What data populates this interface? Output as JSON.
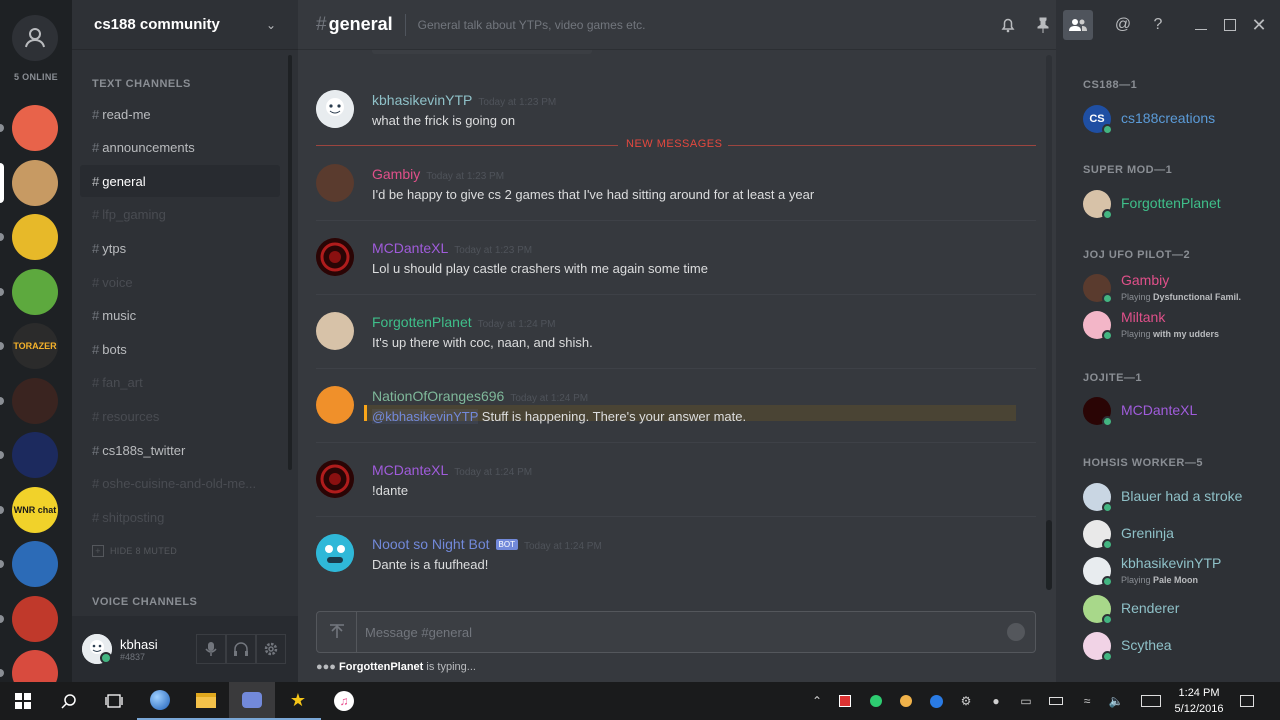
{
  "rail": {
    "online_label": "5 ONLINE",
    "servers": [
      {
        "name": "server-rocket",
        "color": "#e8634a",
        "text": ""
      },
      {
        "name": "server-avatar-guy",
        "color": "#c79a63",
        "text": ""
      },
      {
        "name": "server-fist",
        "color": "#e7b929",
        "text": ""
      },
      {
        "name": "server-apple",
        "color": "#5da93e",
        "text": ""
      },
      {
        "name": "server-torazer",
        "color": "#2b2b2b",
        "text": "TORAZER"
      },
      {
        "name": "server-space",
        "color": "#3a2420",
        "text": ""
      },
      {
        "name": "server-vortex",
        "color": "#1c2a5e",
        "text": ""
      },
      {
        "name": "server-wnr-chat",
        "color": "#f1d22a",
        "text": "WNR chat"
      },
      {
        "name": "server-santa-horse",
        "color": "#2c6bb7",
        "text": ""
      },
      {
        "name": "server-game",
        "color": "#c0392b",
        "text": ""
      },
      {
        "name": "server-mario",
        "color": "#d84b3e",
        "text": ""
      }
    ]
  },
  "guild": {
    "name": "cs188 community",
    "text_channels_label": "TEXT CHANNELS",
    "voice_channels_label": "VOICE CHANNELS",
    "hide_muted_label": "HIDE 8 MUTED",
    "channels": [
      {
        "label": "read-me",
        "state": "unread"
      },
      {
        "label": "announcements",
        "state": "unread"
      },
      {
        "label": "general",
        "state": "active"
      },
      {
        "label": "lfp_gaming",
        "state": "muted"
      },
      {
        "label": "ytps",
        "state": "unread"
      },
      {
        "label": "voice",
        "state": "muted"
      },
      {
        "label": "music",
        "state": "unread"
      },
      {
        "label": "bots",
        "state": "unread"
      },
      {
        "label": "fan_art",
        "state": "muted"
      },
      {
        "label": "resources",
        "state": "muted"
      },
      {
        "label": "cs188s_twitter",
        "state": "unread"
      },
      {
        "label": "oshe-cuisine-and-old-me...",
        "state": "muted"
      },
      {
        "label": "shitposting",
        "state": "muted"
      }
    ]
  },
  "user": {
    "name": "kbhasi",
    "tag": "#4837"
  },
  "chat": {
    "channel_name": "general",
    "topic": "General talk about YTPs, video games etc.",
    "new_messages_label": "NEW MESSAGES",
    "composer_placeholder": "Message #general",
    "typing_user": "ForgottenPlanet",
    "typing_suffix": "is typing...",
    "bot_badge": "BOT",
    "messages": [
      {
        "author": "kbhasikevinYTP",
        "color": "#8fc1c8",
        "time": "Today at 1:23 PM",
        "text": "what the frick is going on"
      },
      {
        "author": "Gambiy",
        "color": "#e0508a",
        "time": "Today at 1:23 PM",
        "text": "I'd be happy to give cs 2 games that I've had sitting around for at least a year"
      },
      {
        "author": "MCDanteXL",
        "color": "#a05cdb",
        "time": "Today at 1:23 PM",
        "text": "Lol u should play castle crashers with me again some time"
      },
      {
        "author": "ForgottenPlanet",
        "color": "#3fbf8a",
        "time": "Today at 1:24 PM",
        "text": "It's up there with coc, naan, and shish."
      },
      {
        "author": "NationOfOranges696",
        "color": "#7fb89a",
        "time": "Today at 1:24 PM",
        "mention": "@kbhasikevinYTP",
        "text": "Stuff is happening. There's your answer mate."
      },
      {
        "author": "MCDanteXL",
        "color": "#a05cdb",
        "time": "Today at 1:24 PM",
        "text": "!dante"
      },
      {
        "author": "Nooot so Night Bot",
        "color": "#7289da",
        "time": "Today at 1:24 PM",
        "text": "Dante is a fuufhead!"
      }
    ]
  },
  "members": {
    "groups": [
      {
        "label": "CS188—1",
        "members": [
          {
            "name": "cs188creations",
            "color": "#5b9bd8"
          }
        ]
      },
      {
        "label": "SUPER MOD—1",
        "members": [
          {
            "name": "ForgottenPlanet",
            "color": "#3fbf8a"
          }
        ]
      },
      {
        "label": "JOJ UFO PILOT—2",
        "members": [
          {
            "name": "Gambiy",
            "color": "#e0508a",
            "playing": "Playing",
            "game": "Dysfunctional Famil..."
          },
          {
            "name": "Miltank",
            "color": "#e0508a",
            "playing": "Playing",
            "game": "with my udders"
          }
        ]
      },
      {
        "label": "JOJITE—1",
        "members": [
          {
            "name": "MCDanteXL",
            "color": "#a05cdb"
          }
        ]
      },
      {
        "label": "HOHSIS WORKER—5",
        "members": [
          {
            "name": "Blauer had a stroke",
            "color": "#8fc1c8"
          },
          {
            "name": "Greninja",
            "color": "#8fc1c8"
          },
          {
            "name": "kbhasikevinYTP",
            "color": "#8fc1c8",
            "playing": "Playing",
            "game": "Pale Moon"
          },
          {
            "name": "Renderer",
            "color": "#8fc1c8"
          },
          {
            "name": "Scythea",
            "color": "#8fc1c8"
          }
        ]
      }
    ]
  },
  "taskbar": {
    "time": "1:24 PM",
    "date": "5/12/2016"
  }
}
